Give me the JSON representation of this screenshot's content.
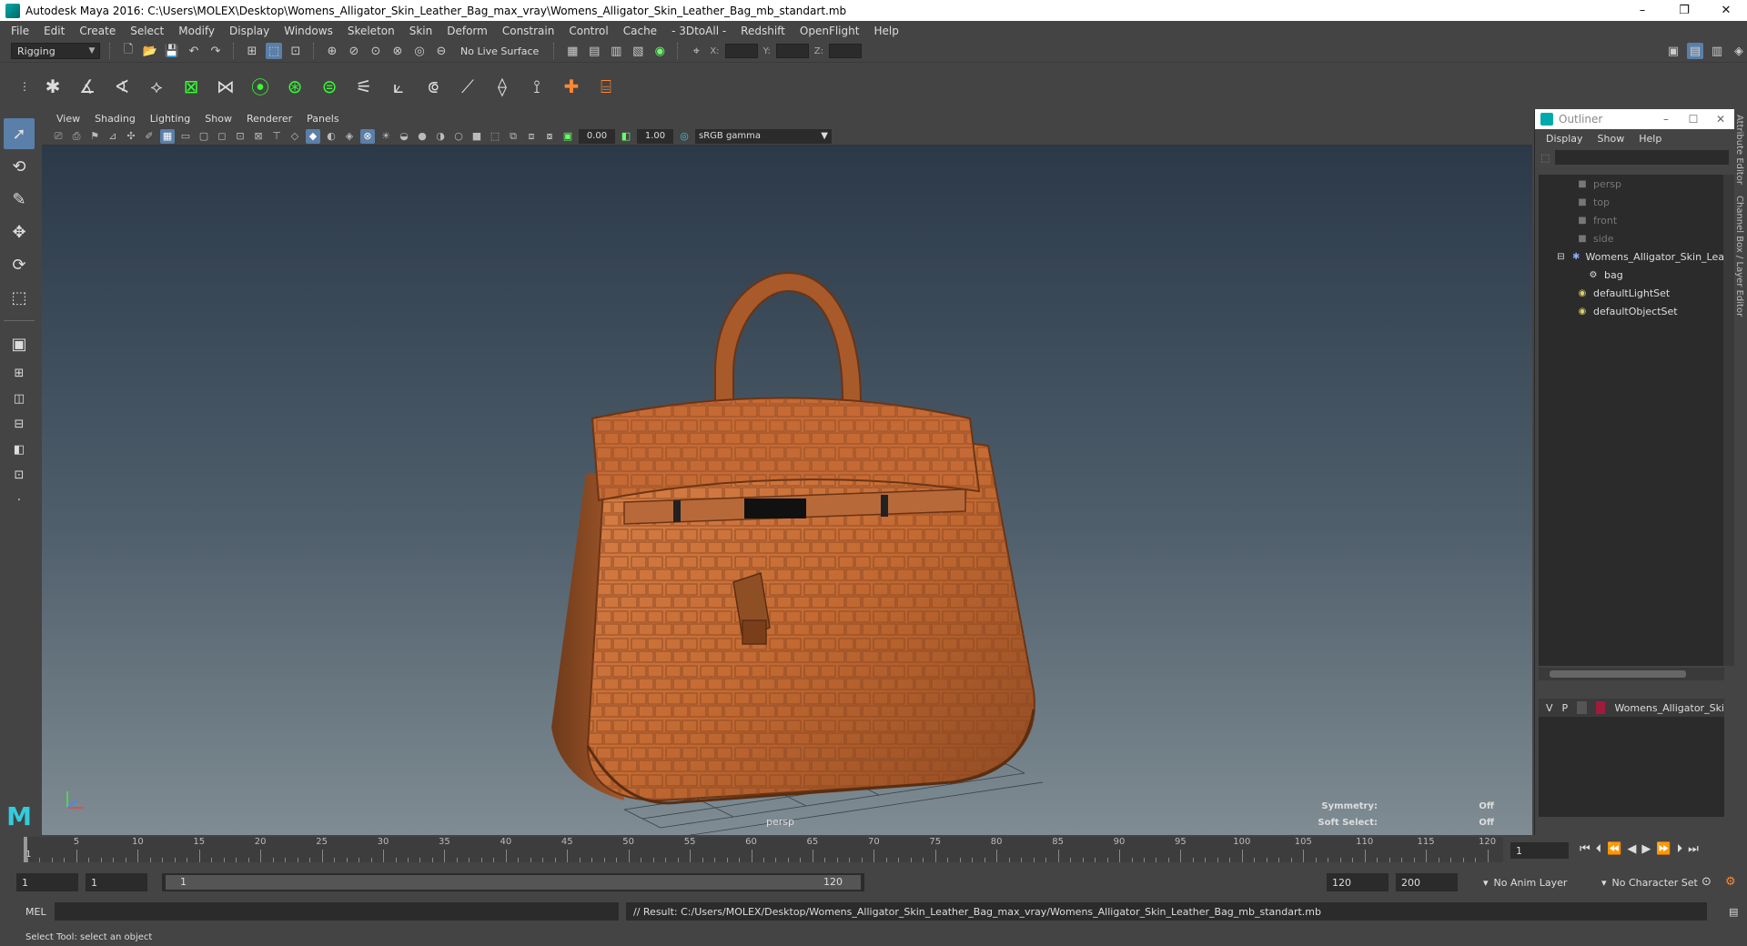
{
  "window": {
    "title": "Autodesk Maya 2016: C:\\Users\\MOLEX\\Desktop\\Womens_Alligator_Skin_Leather_Bag_max_vray\\Womens_Alligator_Skin_Leather_Bag_mb_standart.mb",
    "minimize": "–",
    "restore": "❐",
    "close": "✕"
  },
  "menubar": [
    "File",
    "Edit",
    "Create",
    "Select",
    "Modify",
    "Display",
    "Windows",
    "Skeleton",
    "Skin",
    "Deform",
    "Constrain",
    "Control",
    "Cache",
    "- 3DtoAll -",
    "Redshift",
    "OpenFlight",
    "Help"
  ],
  "status": {
    "mode": "Rigging",
    "live_surface": "No Live Surface",
    "x_label": "X:",
    "y_label": "Y:",
    "z_label": "Z:"
  },
  "panel": {
    "menu": [
      "View",
      "Shading",
      "Lighting",
      "Show",
      "Renderer",
      "Panels"
    ],
    "exposure": "0.00",
    "gamma": "1.00",
    "color_space": "sRGB gamma",
    "camera": "persp",
    "symmetry_label": "Symmetry:",
    "symmetry_value": "Off",
    "soft_select_label": "Soft Select:",
    "soft_select_value": "Off"
  },
  "outliner": {
    "title": "Outliner",
    "menu": [
      "Display",
      "Show",
      "Help"
    ],
    "items": [
      {
        "label": "persp",
        "icon": "camera-icon",
        "dim": true
      },
      {
        "label": "top",
        "icon": "camera-icon",
        "dim": true
      },
      {
        "label": "front",
        "icon": "camera-icon",
        "dim": true
      },
      {
        "label": "side",
        "icon": "camera-icon",
        "dim": true
      },
      {
        "label": "Womens_Alligator_Skin_Lea",
        "icon": "group-icon",
        "dim": false
      },
      {
        "label": "bag",
        "icon": "mesh-icon",
        "dim": false
      },
      {
        "label": "defaultLightSet",
        "icon": "set-icon",
        "dim": false
      },
      {
        "label": "defaultObjectSet",
        "icon": "set-icon",
        "dim": false
      }
    ],
    "layer": {
      "v": "V",
      "p": "P",
      "name": "Womens_Alligator_Ski",
      "color": "#a01b3a"
    }
  },
  "timeline": {
    "ticks": [
      5,
      10,
      15,
      20,
      25,
      30,
      35,
      40,
      45,
      50,
      55,
      60,
      65,
      70,
      75,
      80,
      85,
      90,
      95,
      100,
      105,
      110,
      115,
      120
    ],
    "start_label": "1",
    "current": "1"
  },
  "range": {
    "start": "1",
    "current_start": "1",
    "bar_start": "1",
    "bar_end": "120",
    "end": "120",
    "max": "200",
    "anim_layer": "No Anim Layer",
    "character_set": "No Character Set"
  },
  "command": {
    "language": "MEL",
    "result": "// Result: C:/Users/MOLEX/Desktop/Womens_Alligator_Skin_Leather_Bag_max_vray/Womens_Alligator_Skin_Leather_Bag_mb_standart.mb"
  },
  "help": "Select Tool: select an object",
  "side_tabs": [
    "Attribute Editor",
    "Channel Box / Layer Editor"
  ]
}
